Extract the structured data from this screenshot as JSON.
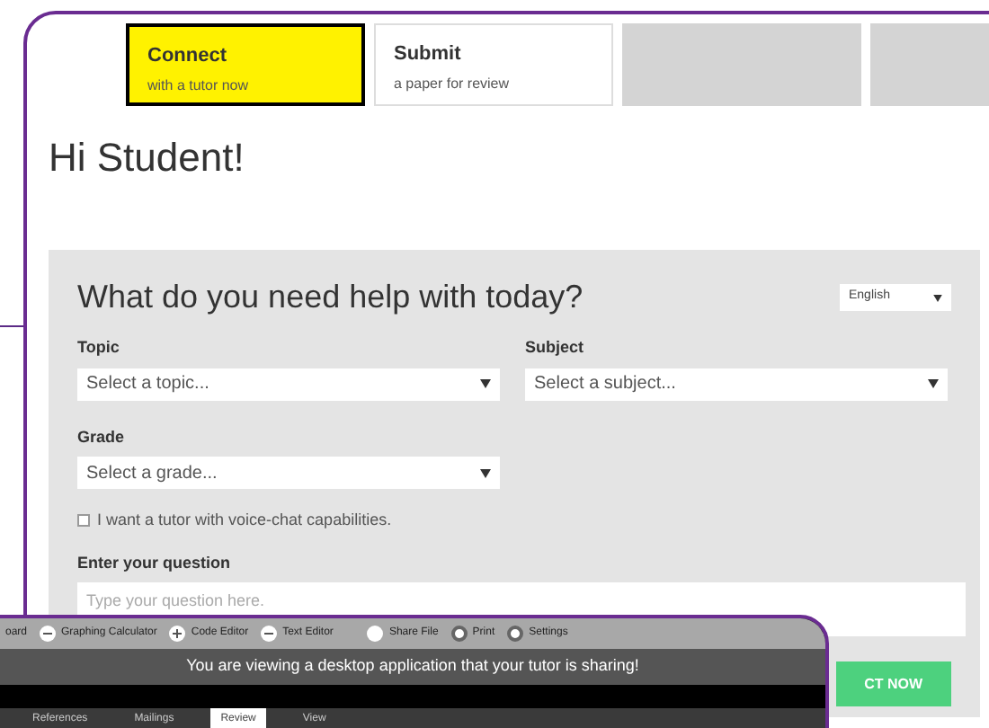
{
  "nav": {
    "tabs": [
      {
        "kind": "action",
        "title": "Connect",
        "subtitle": "with a tutor now",
        "selected": true
      },
      {
        "kind": "action",
        "title": "Submit",
        "subtitle": "a paper for review",
        "selected": false
      },
      {
        "kind": "blank",
        "selected": false
      },
      {
        "kind": "blank",
        "selected": false
      }
    ]
  },
  "greeting": "Hi Student!",
  "form": {
    "heading": "What do you need help with today?",
    "language": "English",
    "topic": {
      "label": "Topic",
      "placeholder": "Select a topic..."
    },
    "subject": {
      "label": "Subject",
      "placeholder": "Select a subject..."
    },
    "grade": {
      "label": "Grade",
      "placeholder": "Select a grade..."
    },
    "voice_chat": {
      "label": "I want a tutor with voice-chat capabilities.",
      "checked": false
    },
    "question": {
      "label": "Enter your question",
      "placeholder": "Type your question here."
    },
    "submit": "CT NOW"
  },
  "shared_window": {
    "tools": [
      {
        "kind": "plain",
        "label": "oard"
      },
      {
        "kind": "minus",
        "label": "Graphing Calculator"
      },
      {
        "kind": "plus",
        "label": "Code Editor"
      },
      {
        "kind": "minus",
        "label": "Text Editor"
      },
      {
        "kind": "gap",
        "label": "Share File"
      },
      {
        "kind": "circle",
        "label": "Print"
      },
      {
        "kind": "circle",
        "label": "Settings"
      }
    ],
    "banner": "You are viewing a desktop application that your tutor is sharing!",
    "ribbon_tabs": [
      {
        "label": "References",
        "selected": false
      },
      {
        "label": "Mailings",
        "selected": false
      },
      {
        "label": "Review",
        "selected": true
      },
      {
        "label": "View",
        "selected": false
      }
    ]
  }
}
